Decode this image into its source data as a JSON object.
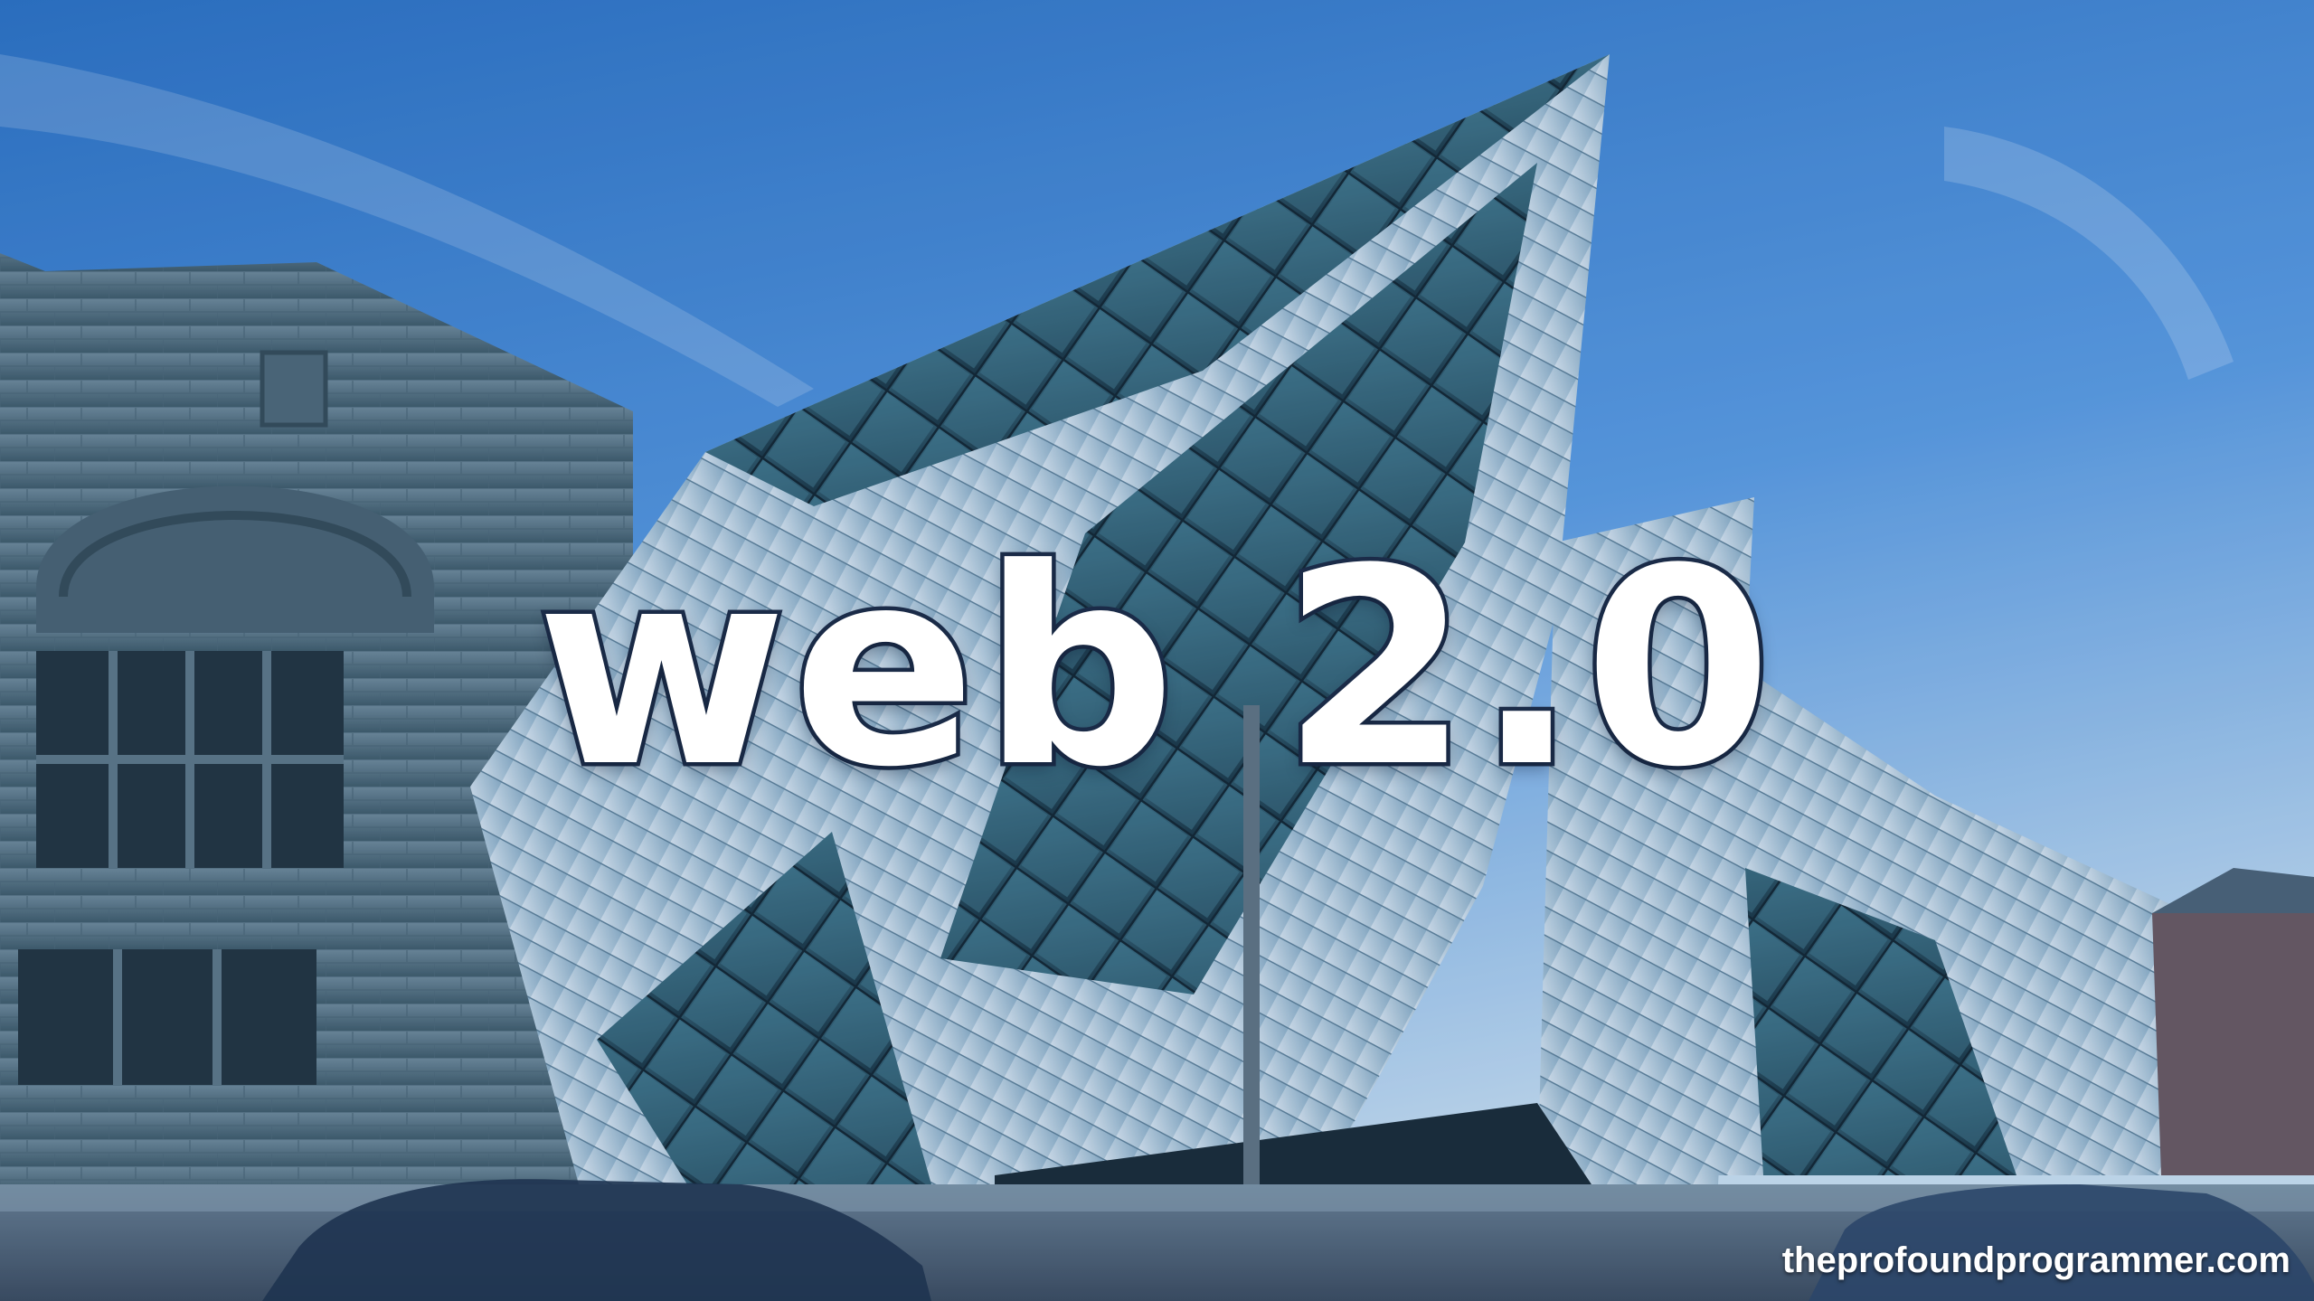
{
  "title": "web 2.0",
  "watermark": "theprofoundprogrammer.com",
  "colors": {
    "sky_top": "#2a6fc0",
    "sky_bottom": "#cfe3f0",
    "stone": "#5d7580",
    "glass": "#2b5a66",
    "cladding": "#b9d3e2",
    "title_fill": "#ffffff",
    "title_outline": "#1c2d4a"
  }
}
